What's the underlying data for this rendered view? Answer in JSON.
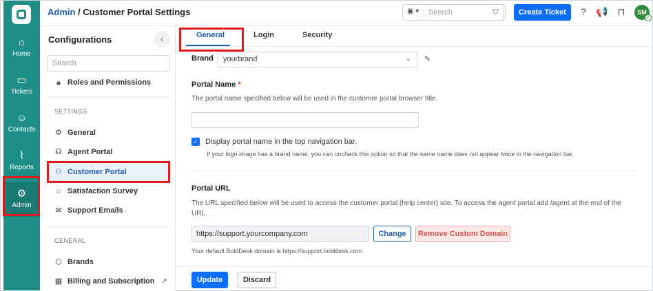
{
  "header": {
    "breadcrumb_link": "Admin",
    "breadcrumb_sep": " / ",
    "breadcrumb_current": "Customer Portal Settings",
    "search_placeholder": "Search",
    "create_ticket": "Create Ticket",
    "avatar_initials": "SM"
  },
  "rail": {
    "items": [
      {
        "label": "Home",
        "icon": "home-icon"
      },
      {
        "label": "Tickets",
        "icon": "ticket-icon"
      },
      {
        "label": "Contacts",
        "icon": "contact-icon"
      },
      {
        "label": "Reports",
        "icon": "chart-icon"
      },
      {
        "label": "Admin",
        "icon": "gear-icon"
      }
    ]
  },
  "config": {
    "title": "Configurations",
    "search_placeholder": "Search",
    "roles": "Roles and Permissions",
    "settings_heading": "SETTINGS",
    "settings_items": [
      "General",
      "Agent Portal",
      "Customer Portal",
      "Satisfaction Survey",
      "Support Emails"
    ],
    "general_heading": "GENERAL",
    "general_items": [
      "Brands",
      "Billing and Subscription"
    ]
  },
  "tabs": [
    "General",
    "Login",
    "Security"
  ],
  "form": {
    "brand_label": "Brand",
    "brand_value": "yourbrand",
    "portal_name_label": "Portal Name",
    "portal_name_required": "*",
    "portal_name_help": "The portal name specified below will be used in the customer portal browser title.",
    "portal_name_value": "",
    "display_checkbox_label": "Display portal name in the top navigation bar.",
    "display_checkbox_help": "If your logo image has a brand name, you can uncheck this option so that the same name does not appear twice in the navigation bar.",
    "portal_url_label": "Portal URL",
    "portal_url_help_1": "The URL specified below will be used to access the customer portal (help center) site. To access the agent portal add /agent at the end of the",
    "portal_url_help_2": "URL.",
    "portal_url_value": "https://support.yourcompany.com",
    "change_button": "Change",
    "remove_button": "Remove Custom Domain",
    "default_domain_note": "Your default BoldDesk domain is https://support.bolddesk.com",
    "update_button": "Update",
    "discard_button": "Discard"
  },
  "colors": {
    "rail": "#1e8f87",
    "primary": "#0d6efd",
    "highlight": "#e01b1b"
  }
}
